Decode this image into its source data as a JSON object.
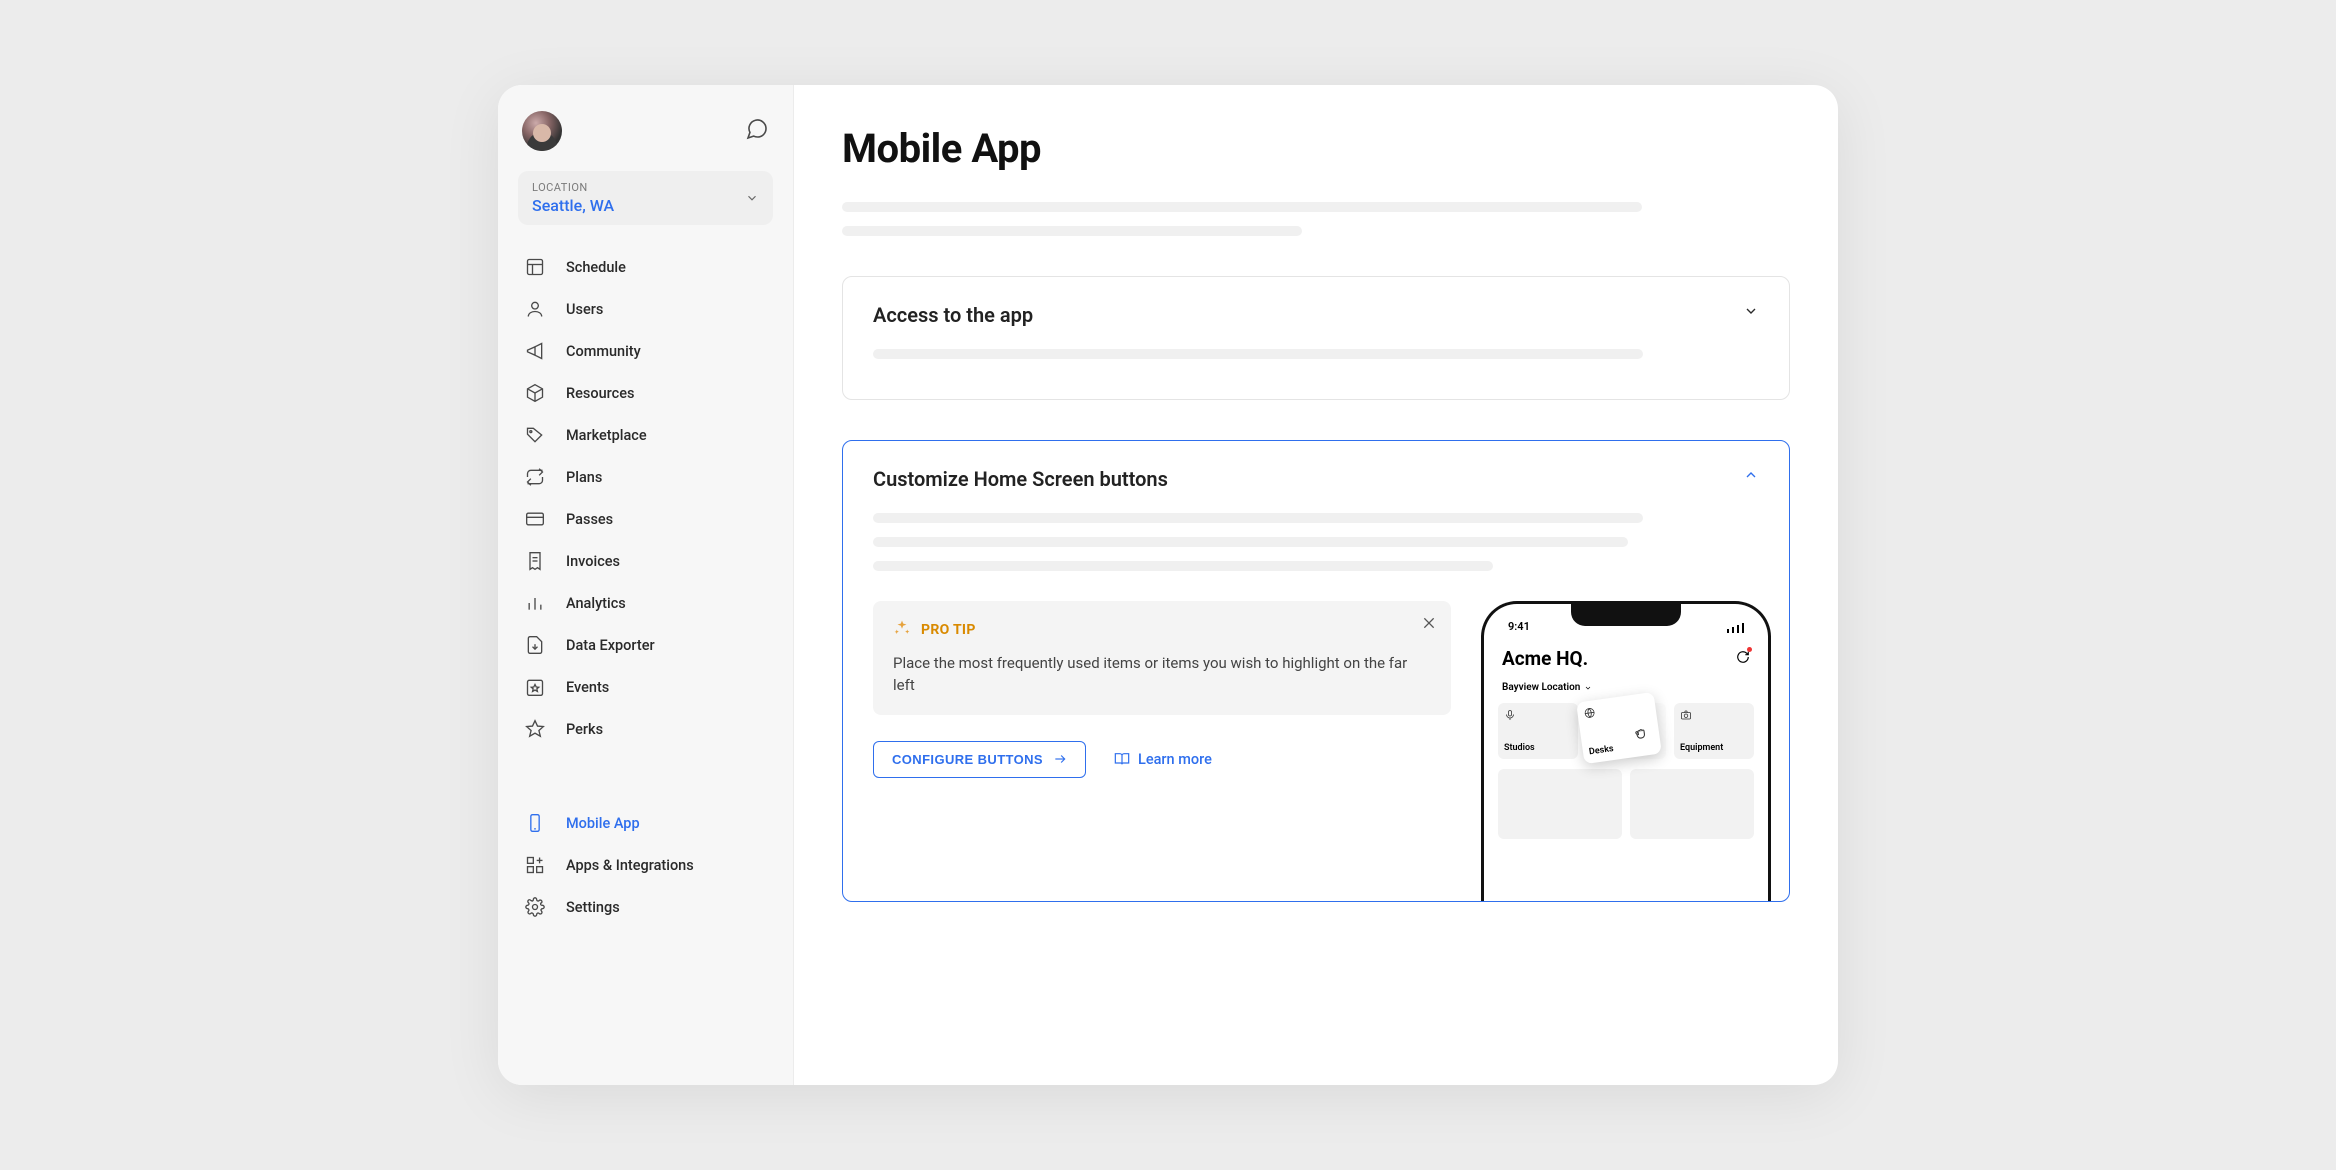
{
  "sidebar": {
    "location_label": "LOCATION",
    "location_value": "Seattle, WA",
    "items": [
      {
        "id": "schedule",
        "label": "Schedule"
      },
      {
        "id": "users",
        "label": "Users"
      },
      {
        "id": "community",
        "label": "Community"
      },
      {
        "id": "resources",
        "label": "Resources"
      },
      {
        "id": "marketplace",
        "label": "Marketplace"
      },
      {
        "id": "plans",
        "label": "Plans"
      },
      {
        "id": "passes",
        "label": "Passes"
      },
      {
        "id": "invoices",
        "label": "Invoices"
      },
      {
        "id": "analytics",
        "label": "Analytics"
      },
      {
        "id": "data-exporter",
        "label": "Data Exporter"
      },
      {
        "id": "events",
        "label": "Events"
      },
      {
        "id": "perks",
        "label": "Perks"
      }
    ],
    "secondary": [
      {
        "id": "mobile-app",
        "label": "Mobile App",
        "active": true
      },
      {
        "id": "apps-integrations",
        "label": "Apps & Integrations"
      },
      {
        "id": "settings",
        "label": "Settings"
      }
    ]
  },
  "page": {
    "title": "Mobile App"
  },
  "cards": {
    "access": {
      "title": "Access to the app"
    },
    "customize": {
      "title": "Customize Home Screen buttons",
      "pro_tip_badge": "PRO TIP",
      "pro_tip_text": "Place the most frequently used items or items you wish to highlight on the far left",
      "configure_label": "CONFIGURE BUTTONS",
      "learn_more_label": "Learn more"
    }
  },
  "phone": {
    "time": "9:41",
    "app_name": "Acme HQ.",
    "location": "Bayview Location",
    "tiles": [
      {
        "label": "Studios"
      },
      {
        "label": "Desks"
      },
      {
        "label": "Equipment"
      }
    ]
  }
}
